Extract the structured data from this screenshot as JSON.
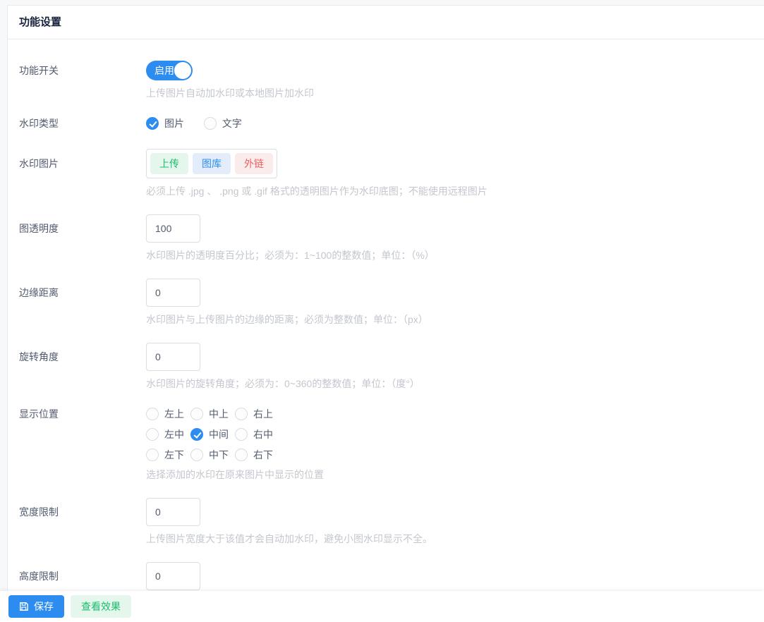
{
  "page": {
    "title": "功能设置"
  },
  "colors": {
    "primary": "#2d8cf0",
    "success": "#19be6b",
    "error": "#ed6262",
    "help_text": "#c3c7ce",
    "border": "#dcdee2"
  },
  "toggle_row": {
    "label": "功能开关",
    "state_label": "启用",
    "enabled": true,
    "help": "上传图片自动加水印或本地图片加水印"
  },
  "type_row": {
    "label": "水印类型",
    "options": [
      {
        "label": "图片",
        "checked": true
      },
      {
        "label": "文字",
        "checked": false
      }
    ]
  },
  "image_row": {
    "label": "水印图片",
    "buttons": [
      {
        "label": "上传"
      },
      {
        "label": "图库"
      },
      {
        "label": "外链"
      }
    ],
    "help": "必须上传 .jpg 、 .png 或 .gif 格式的透明图片作为水印底图；不能使用远程图片"
  },
  "opacity_row": {
    "label": "图透明度",
    "value": "100",
    "help": "水印图片的透明度百分比；必须为：1~100的整数值；单位：（%）"
  },
  "margin_row": {
    "label": "边缘距离",
    "value": "0",
    "help": "水印图片与上传图片的边缘的距离；必须为整数值；单位：（px）"
  },
  "rotate_row": {
    "label": "旋转角度",
    "value": "0",
    "help": "水印图片的旋转角度；必须为：0~360的整数值；单位：（度°）"
  },
  "position_row": {
    "label": "显示位置",
    "selected": "中间",
    "options": [
      {
        "label": "左上",
        "checked": false
      },
      {
        "label": "中上",
        "checked": false
      },
      {
        "label": "右上",
        "checked": false
      },
      {
        "label": "左中",
        "checked": false
      },
      {
        "label": "中间",
        "checked": true
      },
      {
        "label": "右中",
        "checked": false
      },
      {
        "label": "左下",
        "checked": false
      },
      {
        "label": "中下",
        "checked": false
      },
      {
        "label": "右下",
        "checked": false
      }
    ],
    "help": "选择添加的水印在原来图片中显示的位置"
  },
  "width_row": {
    "label": "宽度限制",
    "value": "0",
    "help": "上传图片宽度大于该值才会自动加水印，避免小图水印显示不全。"
  },
  "height_row": {
    "label": "高度限制",
    "value": "0"
  },
  "footer": {
    "save_label": "保存",
    "save_icon": "floppy-disk",
    "preview_label": "查看效果"
  }
}
